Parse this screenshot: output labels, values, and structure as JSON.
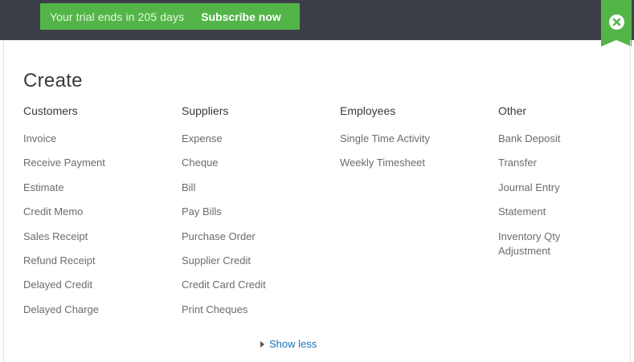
{
  "banner": {
    "trial_text": "Your trial ends in 205 days",
    "subscribe_label": "Subscribe now"
  },
  "panel": {
    "title": "Create",
    "show_less_label": "Show less"
  },
  "columns": {
    "customers": {
      "heading": "Customers",
      "items": [
        "Invoice",
        "Receive Payment",
        "Estimate",
        "Credit Memo",
        "Sales Receipt",
        "Refund Receipt",
        "Delayed Credit",
        "Delayed Charge"
      ]
    },
    "suppliers": {
      "heading": "Suppliers",
      "items": [
        "Expense",
        "Cheque",
        "Bill",
        "Pay Bills",
        "Purchase Order",
        "Supplier Credit",
        "Credit Card Credit",
        "Print Cheques"
      ]
    },
    "employees": {
      "heading": "Employees",
      "items": [
        "Single Time Activity",
        "Weekly Timesheet"
      ]
    },
    "other": {
      "heading": "Other",
      "items": [
        "Bank Deposit",
        "Transfer",
        "Journal Entry",
        "Statement",
        "Inventory Qty Adjustment"
      ]
    }
  },
  "colors": {
    "topbar": "#3d3f48",
    "accent_green": "#53b548",
    "link_blue": "#1475bd"
  },
  "icons": {
    "close": "close-icon",
    "show_less": "caret-right-icon"
  }
}
